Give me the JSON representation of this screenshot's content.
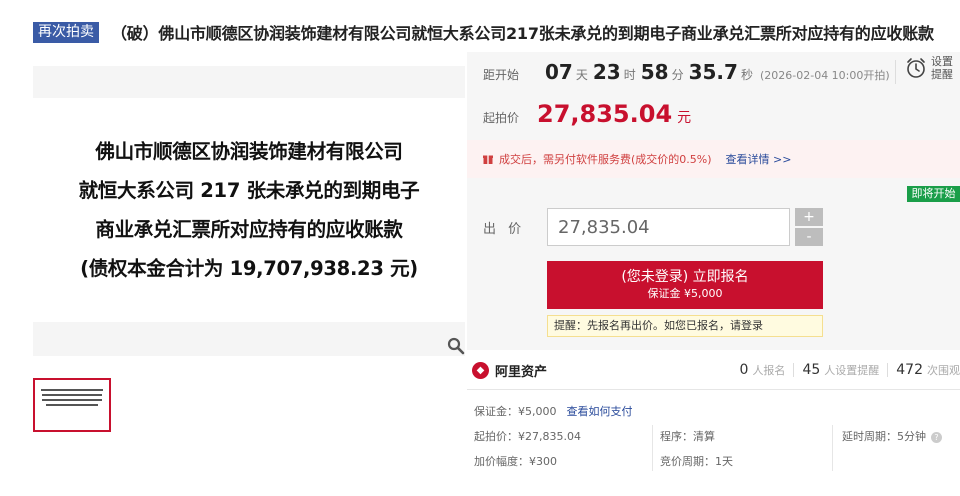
{
  "header": {
    "tag": "再次拍卖",
    "title": "（破）佛山市顺德区协润装饰建材有限公司就恒大系公司217张未承兑的到期电子商业承兑汇票所对应持有的应收账款"
  },
  "gallery": {
    "main_lines": [
      "佛山市顺德区协润装饰建材有限公司",
      "就恒大系公司 217 张未承兑的到期电子",
      "商业承兑汇票所对应持有的应收账款",
      "(债权本金合计为 19,707,938.23 元)"
    ]
  },
  "countdown": {
    "label": "距开始",
    "days": "07",
    "days_unit": "天",
    "hours": "23",
    "hours_unit": "时",
    "minutes": "58",
    "minutes_unit": "分",
    "seconds": "35.7",
    "seconds_unit": "秒",
    "start_time": "(2026-02-04 10:00开拍)"
  },
  "reminder": {
    "label_line1": "设置",
    "label_line2": "提醒",
    "icon": "alarm-clock-icon"
  },
  "starting_price": {
    "label": "起拍价",
    "value": "27,835.04",
    "unit": "元"
  },
  "notice": {
    "text": "成交后，需另付软件服务费(成交价的0.5%)",
    "link": "查看详情 >>"
  },
  "status_badge": "即将开始",
  "bid": {
    "label": "出 价",
    "value": "27,835.04",
    "plus": "+",
    "minus": "-",
    "button_line1": "(您未登录) 立即报名",
    "button_line2": "保证金 ¥5,000",
    "tip": "提醒：先报名再出价。如您已报名，请登录"
  },
  "platform": {
    "name": "阿里资产",
    "signups": "0",
    "signups_label": "人报名",
    "reminders": "45",
    "reminders_label": "人设置提醒",
    "views": "472",
    "views_label": "次围观"
  },
  "info": {
    "deposit": "保证金：¥5,000",
    "deposit_link": "查看如何支付",
    "start_price": "起拍价：¥27,835.04",
    "increment": "加价幅度：¥300",
    "procedure": "程序：清算",
    "cycle": "竞价周期：1天",
    "delay": "延时周期：5分钟"
  },
  "colors": {
    "accent_red": "#c8102e",
    "tag_blue": "#3a5ba6",
    "link_blue": "#2a4b9b",
    "badge_green": "#1a9e49"
  }
}
